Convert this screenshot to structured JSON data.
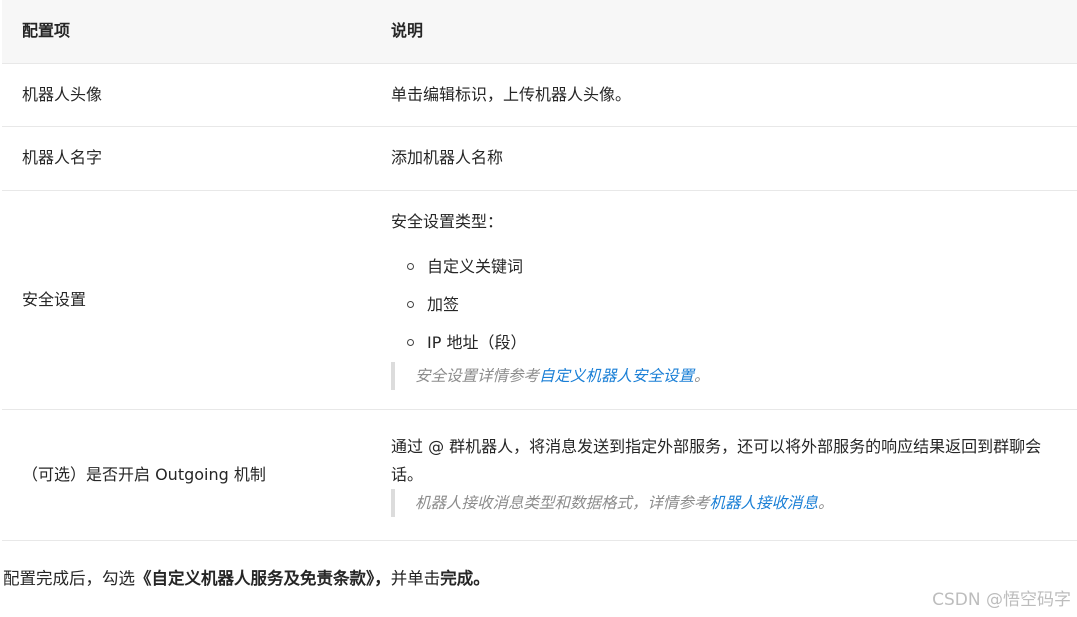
{
  "table": {
    "headers": [
      "配置项",
      "说明"
    ],
    "rows": {
      "avatar": {
        "item": "机器人头像",
        "desc": "单击编辑标识，上传机器人头像。"
      },
      "name": {
        "item": "机器人名字",
        "desc": "添加机器人名称"
      },
      "security": {
        "item": "安全设置",
        "lead": "安全设置类型：",
        "options": [
          "自定义关键词",
          "加签",
          "IP 地址（段）"
        ],
        "note_prefix": "安全设置详情参考",
        "note_link": "自定义机器人安全设置",
        "note_suffix": "。"
      },
      "outgoing": {
        "item": "（可选）是否开启 Outgoing 机制",
        "desc": "通过 @ 群机器人，将消息发送到指定外部服务，还可以将外部服务的响应结果返回到群聊会话。",
        "note_prefix": "机器人接收消息类型和数据格式，详情参考",
        "note_link": "机器人接收消息",
        "note_suffix": "。"
      }
    }
  },
  "footer": {
    "prefix": "配置完成后，勾选",
    "terms": "《自定义机器人服务及免责条款》，",
    "middle": "并单击",
    "action": "完成。"
  },
  "watermark": "CSDN @悟空码字",
  "colors": {
    "link": "#1a7fd6",
    "header_bg": "#f7f7f7",
    "border": "#e8e8e8"
  }
}
